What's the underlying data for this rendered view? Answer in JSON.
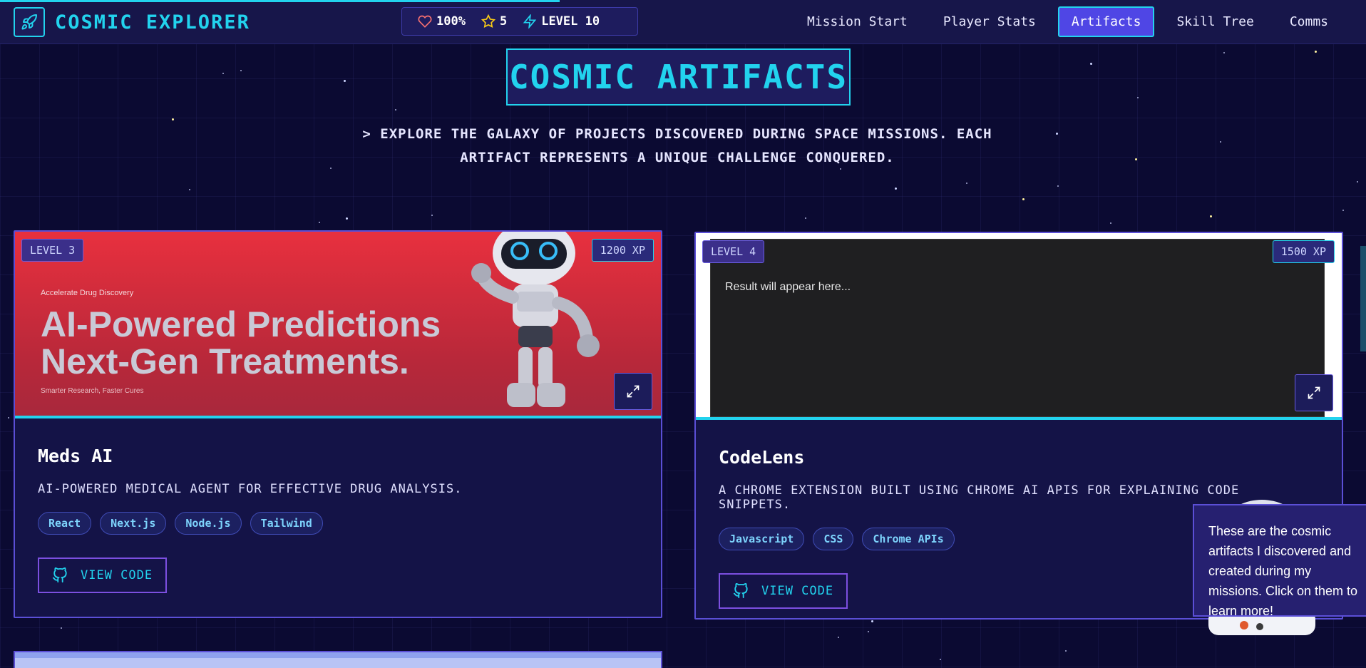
{
  "header": {
    "brand_title": "COSMIC EXPLORER",
    "brand_icon": "rocket-icon",
    "stats": {
      "health": "100%",
      "stars": "5",
      "level": "LEVEL 10"
    },
    "nav": [
      {
        "label": "Mission Start",
        "active": false
      },
      {
        "label": "Player Stats",
        "active": false
      },
      {
        "label": "Artifacts",
        "active": true
      },
      {
        "label": "Skill Tree",
        "active": false
      },
      {
        "label": "Comms",
        "active": false
      }
    ]
  },
  "page": {
    "title": "COSMIC ARTIFACTS",
    "subtitle_line1": "> EXPLORE THE GALAXY OF PROJECTS DISCOVERED DURING SPACE MISSIONS. EACH",
    "subtitle_line2": "ARTIFACT REPRESENTS A UNIQUE CHALLENGE CONQUERED."
  },
  "cards": [
    {
      "level": "LEVEL 3",
      "xp": "1200 XP",
      "title": "Meds AI",
      "description": "AI-POWERED MEDICAL AGENT FOR EFFECTIVE DRUG ANALYSIS.",
      "tags": [
        "React",
        "Next.js",
        "Node.js",
        "Tailwind"
      ],
      "button": "VIEW CODE",
      "preview": {
        "kicker": "Accelerate Drug Discovery",
        "headline_line1": "AI-Powered Predictions",
        "headline_line2": "Next-Gen Treatments.",
        "tagline": "Smarter Research, Faster Cures"
      }
    },
    {
      "level": "LEVEL 4",
      "xp": "1500 XP",
      "title": "CodeLens",
      "description": "A CHROME EXTENSION BUILT USING CHROME AI APIS FOR EXPLAINING CODE SNIPPETS.",
      "tags": [
        "Javascript",
        "CSS",
        "Chrome APIs"
      ],
      "button": "VIEW CODE",
      "preview": {
        "result_text": "Result will appear here..."
      }
    }
  ],
  "tooltip": {
    "text": "These are the cosmic artifacts I discovered and created during my missions. Click on them to learn more!"
  },
  "colors": {
    "background": "#0b0a32",
    "accent_cyan": "#22d3ee",
    "accent_indigo": "#4f46e5",
    "card_border": "#5b4fd6"
  }
}
